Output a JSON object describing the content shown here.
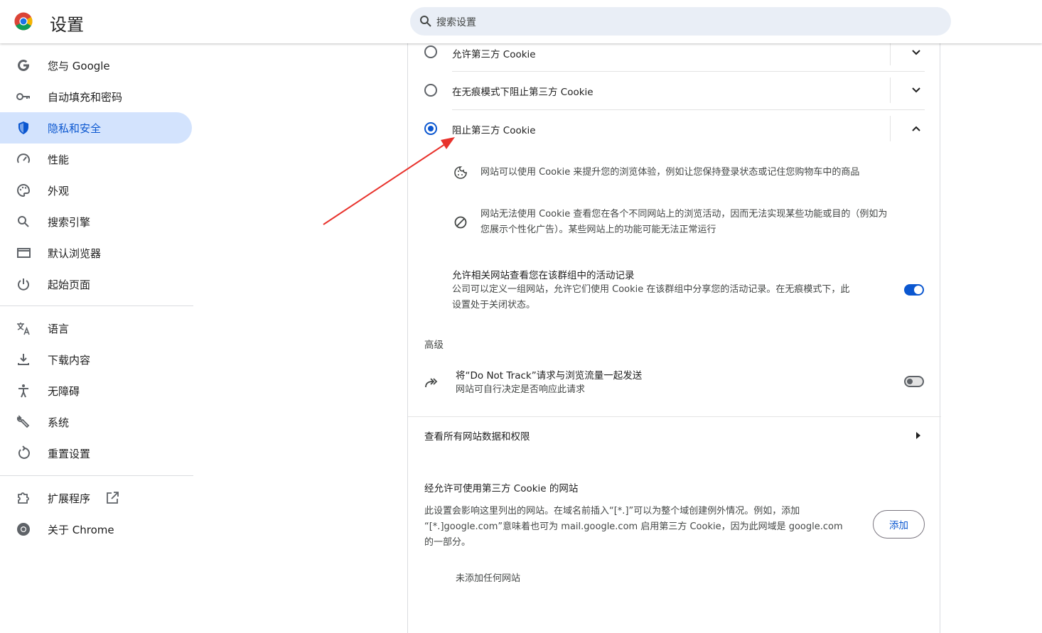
{
  "header": {
    "title": "设置",
    "search_placeholder": "搜索设置"
  },
  "sidebar": {
    "items": [
      {
        "label": "您与 Google",
        "icon": "google-g-icon"
      },
      {
        "label": "自动填充和密码",
        "icon": "key-icon"
      },
      {
        "label": "隐私和安全",
        "icon": "shield-icon",
        "active": true
      },
      {
        "label": "性能",
        "icon": "speedometer-icon"
      },
      {
        "label": "外观",
        "icon": "palette-icon"
      },
      {
        "label": "搜索引擎",
        "icon": "search-icon"
      },
      {
        "label": "默认浏览器",
        "icon": "browser-window-icon"
      },
      {
        "label": "起始页面",
        "icon": "power-icon"
      },
      {
        "label": "语言",
        "icon": "translate-icon"
      },
      {
        "label": "下载内容",
        "icon": "download-icon"
      },
      {
        "label": "无障碍",
        "icon": "accessibility-icon"
      },
      {
        "label": "系统",
        "icon": "wrench-icon"
      },
      {
        "label": "重置设置",
        "icon": "restore-icon"
      },
      {
        "label": "扩展程序",
        "icon": "puzzle-icon"
      },
      {
        "label": "关于 Chrome",
        "icon": "chrome-icon"
      }
    ]
  },
  "cookies": {
    "options": [
      {
        "label": "允许第三方 Cookie",
        "selected": false
      },
      {
        "label": "在无痕模式下阻止第三方 Cookie",
        "selected": false
      },
      {
        "label": "阻止第三方 Cookie",
        "selected": true
      }
    ],
    "details": [
      {
        "icon": "cookie-icon",
        "text": "网站可以使用 Cookie 来提升您的浏览体验，例如让您保持登录状态或记住您购物车中的商品"
      },
      {
        "icon": "block-icon",
        "text_line1": "网站无法使用 Cookie 查看您在各个不同网站上的浏览活动，因而无法实现某些功能或目的（例如为",
        "text_line2": "您展示个性化广告）。某些网站上的功能可能无法正常运行"
      }
    ],
    "related_sites": {
      "title": "允许相关网站查看您在该群组中的活动记录",
      "desc_line1": "公司可以定义一组网站，允许它们使用 Cookie 在该群组中分享您的活动记录。在无痕模式下，此",
      "desc_line2": "设置处于关闭状态。",
      "enabled": true
    },
    "advanced_heading": "高级",
    "dnt": {
      "title": "将“Do Not Track”请求与浏览流量一起发送",
      "desc": "网站可自行决定是否响应此请求",
      "enabled": false
    },
    "all_site_data": "查看所有网站数据和权限",
    "allowed_sites": {
      "heading": "经允许可使用第三方 Cookie 的网站",
      "desc_line1": "此设置会影响这里列出的网站。在域名前插入“[*.]”可以为整个域创建例外情况。例如，添加",
      "desc_line2": "“[*.]google.com”意味着也可为 mail.google.com 启用第三方 Cookie，因为此网域是 google.com",
      "desc_line3": "的一部分。",
      "add_button": "添加",
      "empty_text": "未添加任何网站"
    }
  },
  "colors": {
    "accent": "#0b57d0",
    "active_nav_bg": "#d3e3fd",
    "search_bg": "#e9eef6",
    "annotation_arrow": "#e8322c"
  }
}
